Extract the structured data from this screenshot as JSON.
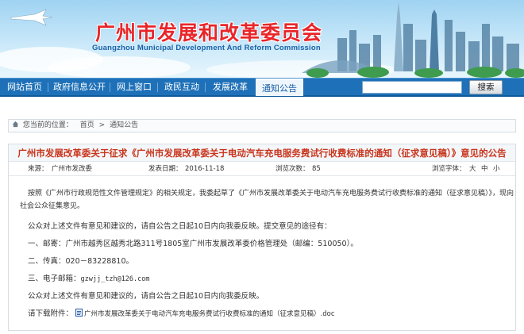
{
  "header": {
    "site_title": "广州市发展和改革委员会",
    "site_subtitle": "Guangzhou Municipal Development And Reform Commission"
  },
  "nav": {
    "items": [
      "网站首页",
      "政府信息公开",
      "网上窗口",
      "政民互动",
      "发展改革",
      "通知公告"
    ],
    "active_index": 5,
    "search_label": "搜索",
    "search_placeholder": ""
  },
  "breadcrumb": {
    "prefix": "您当前的位置：",
    "home": "首页",
    "separator": ">",
    "current": "通知公告"
  },
  "article": {
    "title": "广州市发展改革委关于征求《广州市发展改革委关于电动汽车充电服务费试行收费标准的通知（征求意见稿）》意见的公告",
    "meta": {
      "source_label": "来源：",
      "source": "广州市发改委",
      "date_label": "发表日期：",
      "date": "2016-11-18",
      "views_label": "浏览次数：",
      "views": "85",
      "font_label": "浏览字体：",
      "font_sizes": [
        "大",
        "中",
        "小"
      ]
    },
    "paragraphs": {
      "p1_line1": "按照《广州市行政规范性文件管理规定》的相关规定，我委起草了《广州市发展改革委关于电动汽车充电服务费试行收费标准的通知（征求意见稿）》，现向",
      "p1_line2": "社会公众征集意见。",
      "p2": "公众对上述文件有意见和建议的，请自公告之日起10日内向我委反映。提交意见的途径有：",
      "p3": "一、邮寄：广州市越秀区越秀北路311号1805室广州市发展改革委价格管理处（邮编：510050）。",
      "p4": "二、传真：020－83228810。",
      "p5_label": "三、电子邮箱：",
      "p5_email": "gzwjj_tzh@126.com",
      "p6": "公众对上述文件有意见和建议的，请自公告之日起10日内向我委反映。",
      "attachment_label": "请下载附件：",
      "attachment_name": "广州市发展改革委关于电动汽车充电服务费试行收费标准的通知（征求意见稿）.doc"
    }
  },
  "colors": {
    "nav_bg": "#1e71b8",
    "title_red": "#c9351c",
    "site_title_red": "#e8262a",
    "sky": "#9fd3f2"
  },
  "icons": [
    "plane-icon",
    "home-icon",
    "doc-icon"
  ]
}
